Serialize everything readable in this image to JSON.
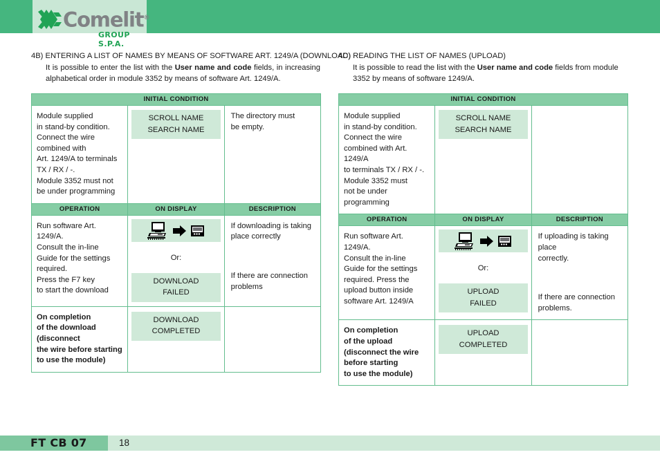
{
  "header": {
    "logo_text": "Comelit",
    "logo_registered": "®",
    "logo_subtitle": "GROUP S.P.A.",
    "band_color": "#45b67f",
    "plate_color": "#c9e7d5",
    "logo_word_color": "#808285",
    "logo_green": "#21a355"
  },
  "sections": [
    {
      "title": "4B) ENTERING A LIST OF NAMES BY MEANS OF SOFTWARE ART. 1249/A (DOWNLOAD)",
      "body_pre": "It is possible to enter the list with the ",
      "body_bold": "User name and code",
      "body_post": " fields, in increasing alphabetical order in module 3352 by means of software Art. 1249/A.",
      "table": {
        "initial_condition_header": "INITIAL CONDITION",
        "initial_condition": {
          "operation": "Module supplied\nin stand-by condition.\nConnect the wire\ncombined with\nArt. 1249/A to terminals\nTX / RX / -.\nModule 3352 must  not\nbe under  programming",
          "display_box": "SCROLL NAME\nSEARCH NAME",
          "description": "The directory must\nbe empty."
        },
        "col_headers": [
          "OPERATION",
          "ON DISPLAY",
          "DESCRIPTION"
        ],
        "rows": [
          {
            "operation": "Run software Art. 1249/A.\nConsult the in-line\nGuide for the settings\nrequired.\nPress the F7 key\nto start the download",
            "operation_bold": false,
            "display_icon": "pc-to-module-transfer-icon",
            "display_or": "Or:",
            "display_box": "DOWNLOAD\nFAILED",
            "description_top": "If downloading is taking\nplace correctly",
            "description_bottom": "If there are connection\nproblems"
          },
          {
            "operation": "On completion\nof the download\n(disconnect\nthe wire before starting\nto use the module)",
            "operation_bold": true,
            "display_box": "DOWNLOAD\nCOMPLETED",
            "description_top": "",
            "description_bottom": ""
          }
        ]
      }
    },
    {
      "title": "4C) READING THE LIST OF NAMES (UPLOAD)",
      "body_pre": "It is possible to read the list with the ",
      "body_bold": "User name and code",
      "body_post": " fields from module 3352 by means of software 1249/A.",
      "table": {
        "initial_condition_header": "INITIAL CONDITION",
        "initial_condition": {
          "operation": "Module supplied\nin stand-by condition.\nConnect the wire\ncombined with Art. 1249/A\nto terminals TX / RX / -.\nModule 3352 must\nnot be under\nprogramming",
          "display_box": "SCROLL NAME\nSEARCH NAME",
          "description": ""
        },
        "col_headers": [
          "OPERATION",
          "ON DISPLAY",
          "DESCRIPTION"
        ],
        "rows": [
          {
            "operation": "Run software Art. 1249/A.\nConsult the in-line\nGuide for the settings\nrequired. Press the\nupload button inside\nsoftware Art. 1249/A",
            "operation_bold": false,
            "display_icon": "pc-to-module-transfer-icon",
            "display_or": "Or:",
            "display_box": "UPLOAD\nFAILED",
            "description_top": "If uploading is taking place\ncorrectly.",
            "description_bottom": "If there are connection\nproblems."
          },
          {
            "operation": "On completion\nof the upload\n(disconnect the wire\nbefore starting\nto use the module)",
            "operation_bold": true,
            "display_box": "UPLOAD\nCOMPLETED",
            "description_top": "",
            "description_bottom": ""
          }
        ]
      }
    }
  ],
  "footer": {
    "doc_code": "FT CB 07",
    "page_number": "18",
    "tab_color": "#7ec79f",
    "bar_color": "#cfe9d8"
  },
  "colors": {
    "table_border": "#63bd8e",
    "table_header_bg": "#86cda5",
    "highlight_bg": "#cfe9d8"
  }
}
